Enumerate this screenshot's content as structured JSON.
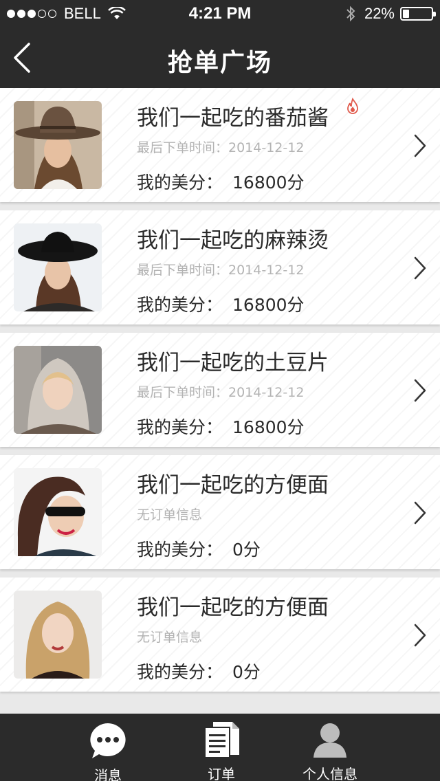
{
  "status_bar": {
    "carrier": "BELL",
    "time": "4:21 PM",
    "battery": "22%",
    "battery_level": 0.22
  },
  "nav": {
    "title": "抢单广场"
  },
  "orders": [
    {
      "title": "我们一起吃的番茄酱",
      "subtitle": "最后下单时间：2014-12-12",
      "score_label": "我的美分：",
      "score_value": "16800分",
      "hot": true
    },
    {
      "title": "我们一起吃的麻辣烫",
      "subtitle": "最后下单时间：2014-12-12",
      "score_label": "我的美分：",
      "score_value": "16800分",
      "hot": false
    },
    {
      "title": "我们一起吃的土豆片",
      "subtitle": "最后下单时间：2014-12-12",
      "score_label": "我的美分：",
      "score_value": "16800分",
      "hot": false
    },
    {
      "title": "我们一起吃的方便面",
      "subtitle": "无订单信息",
      "score_label": "我的美分：",
      "score_value": "0分",
      "hot": false
    },
    {
      "title": "我们一起吃的方便面",
      "subtitle": "无订单信息",
      "score_label": "我的美分：",
      "score_value": "0分",
      "hot": false
    }
  ],
  "tabs": [
    {
      "label": "消息",
      "icon": "chat-bubble-icon"
    },
    {
      "label": "订单",
      "icon": "document-icon"
    },
    {
      "label": "个人信息",
      "icon": "person-icon"
    }
  ],
  "colors": {
    "bar_bg": "#2b2b2b",
    "page_bg": "#e9e9e9",
    "hot_accent": "#e0584a"
  }
}
